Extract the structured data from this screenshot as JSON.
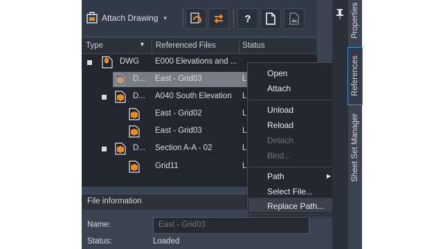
{
  "toolbar": {
    "attach_label": "Attach Drawing",
    "caret": "▾",
    "help_label": "?",
    "buttons": [
      "refresh-icon",
      "unload-icon",
      "help-icon",
      "new-doc-icon",
      "preview-icon"
    ]
  },
  "tree": {
    "columns": [
      "Type",
      "Referenced Files",
      "Status"
    ],
    "sort_indicator": "▼",
    "rows": [
      {
        "type": "DWG",
        "file": "E000 Elevations and ...",
        "status": ""
      },
      {
        "type": "D...",
        "file": "East - Grid03",
        "status": "L"
      },
      {
        "type": "D...",
        "file": "A040 South Elevation",
        "status": "L"
      },
      {
        "type": "",
        "file": "East - Grid02",
        "status": "L"
      },
      {
        "type": "",
        "file": "East - Grid03",
        "status": "L"
      },
      {
        "type": "D...",
        "file": "Section A-A - 02",
        "status": "L"
      },
      {
        "type": "",
        "file": "Grid11",
        "status": "L"
      }
    ]
  },
  "context_menu": {
    "items": [
      "Open",
      "Attach",
      "Unload",
      "Reload",
      "Detach",
      "Bind...",
      "Path",
      "Select File...",
      "Replace Path..."
    ],
    "submenu_arrow": "▶"
  },
  "file_info": {
    "title": "File information",
    "name_label": "Name:",
    "name_value": "East - Grid03",
    "status_label": "Status:",
    "status_value": "Loaded"
  },
  "side_tabs": {
    "pin": "📌",
    "tabs": [
      "Properties",
      "References",
      "Sheet Set Manager"
    ]
  },
  "colors": {
    "accent": "#3a8fd0",
    "icon_orange": "#f08a1e",
    "panel": "#3b4453"
  }
}
